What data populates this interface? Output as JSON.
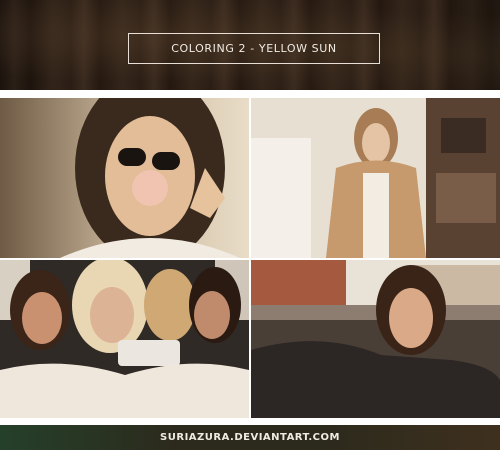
{
  "header": {
    "title": "COLORING 2 - YELLOW SUN"
  },
  "footer": {
    "credit": "SURIAZURA.DEVIANTART.COM"
  },
  "colors": {
    "header_bg": "#2d2018",
    "title_border": "#e8e0d6",
    "footer_bg": "#2c2a1d"
  }
}
